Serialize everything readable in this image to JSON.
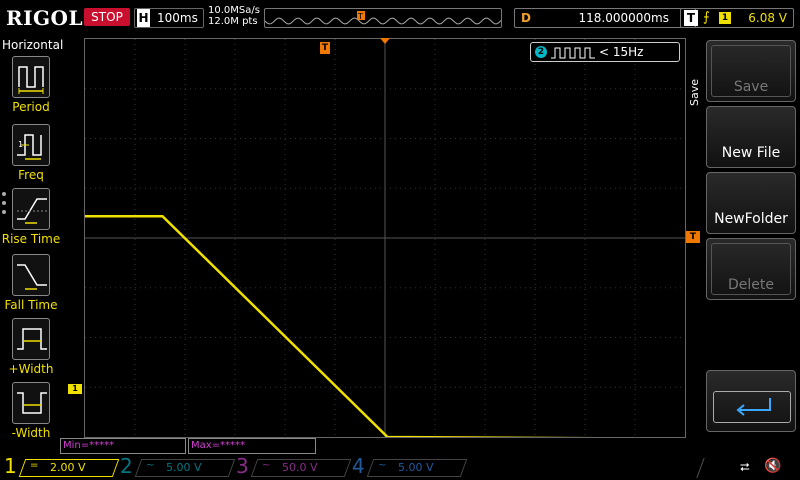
{
  "topbar": {
    "brand": "RIGOL",
    "run_state": "STOP",
    "timebase_label": "H",
    "timebase_value": "100ms",
    "sample_rate": "10.0MSa/s",
    "mem_depth": "12.0M pts",
    "delay_label": "D",
    "delay_value": "118.000000ms",
    "trigger_label": "T",
    "trigger_channel": "1",
    "trigger_level": "6.08 V",
    "trigger_marker": "T"
  },
  "left_menu": {
    "title": "Horizontal",
    "items": [
      {
        "label": "Period",
        "icon": "period-icon"
      },
      {
        "label": "Freq",
        "icon": "freq-icon"
      },
      {
        "label": "Rise Time",
        "icon": "rise-time-icon"
      },
      {
        "label": "Fall Time",
        "icon": "fall-time-icon"
      },
      {
        "label": "+Width",
        "icon": "positive-width-icon"
      },
      {
        "label": "-Width",
        "icon": "negative-width-icon"
      }
    ]
  },
  "screen": {
    "counter_channel": "2",
    "counter_value": "< 15Hz",
    "ch1_marker": "1",
    "trigger_level_marker": "T",
    "min_text": "Min=*****",
    "max_text": "Max=*****"
  },
  "right_menu": {
    "title": "Save",
    "buttons": [
      {
        "label": "Save",
        "enabled": false
      },
      {
        "label": "New File",
        "enabled": true
      },
      {
        "label": "NewFolder",
        "enabled": true
      },
      {
        "label": "Delete",
        "enabled": false
      }
    ]
  },
  "bottombar": {
    "channels": [
      {
        "num": "1",
        "coupling": "=",
        "scale": "2.00 V",
        "active": true
      },
      {
        "num": "2",
        "coupling": "~",
        "scale": "5.00 V",
        "active": false
      },
      {
        "num": "3",
        "coupling": "~",
        "scale": "50.0 V",
        "active": false
      },
      {
        "num": "4",
        "coupling": "~",
        "scale": "5.00 V",
        "active": false
      }
    ]
  },
  "colors": {
    "ch1": "#f0e000",
    "ch2": "#00a8b8",
    "ch3": "#c040c0",
    "ch4": "#3080e0",
    "trigger": "#f07800",
    "stop": "#c8102e"
  },
  "waveform": {
    "trace": [
      {
        "x_div": 0.0,
        "y_div": 6.08
      },
      {
        "x_div": 1.55,
        "y_div": 6.08
      },
      {
        "x_div": 6.05,
        "y_div": 0.0
      },
      {
        "x_div": 12.0,
        "y_div": -0.05
      }
    ],
    "y_offset_div": -4.0
  }
}
